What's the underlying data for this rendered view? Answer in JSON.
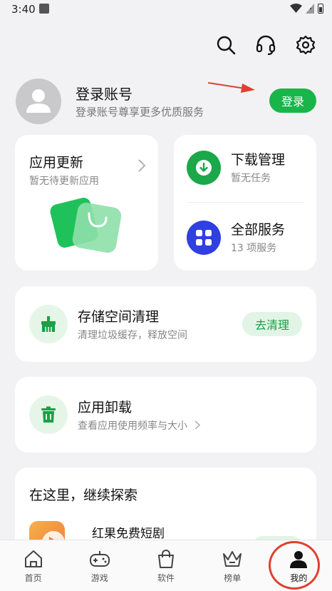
{
  "status_bar": {
    "time": "3:40"
  },
  "top_actions": {
    "icons": [
      "search-icon",
      "headset-icon",
      "gear-icon"
    ]
  },
  "profile": {
    "title": "登录账号",
    "subtitle": "登录账号尊享更多优质服务",
    "login_label": "登录"
  },
  "updates_card": {
    "title": "应用更新",
    "subtitle": "暂无待更新应用"
  },
  "services_card": {
    "download": {
      "title": "下载管理",
      "subtitle": "暂无任务"
    },
    "all": {
      "title": "全部服务",
      "subtitle": "13 项服务"
    }
  },
  "storage_card": {
    "title": "存储空间清理",
    "subtitle": "清理垃圾缓存，释放空间",
    "action": "去清理"
  },
  "uninstall_card": {
    "title": "应用卸载",
    "subtitle": "查看应用使用频率与大小"
  },
  "explore_card": {
    "title": "在这里，继续探索",
    "app_name": "红果免费短剧"
  },
  "bottom_nav": {
    "items": [
      {
        "label": "首页",
        "icon": "home-icon"
      },
      {
        "label": "游戏",
        "icon": "gamepad-icon"
      },
      {
        "label": "软件",
        "icon": "bag-icon"
      },
      {
        "label": "榜单",
        "icon": "crown-icon"
      },
      {
        "label": "我的",
        "icon": "user-icon"
      }
    ],
    "active": "我的"
  },
  "colors": {
    "accent": "#1ab54a",
    "blue": "#2f3fe0",
    "annotation": "#e0402f"
  }
}
